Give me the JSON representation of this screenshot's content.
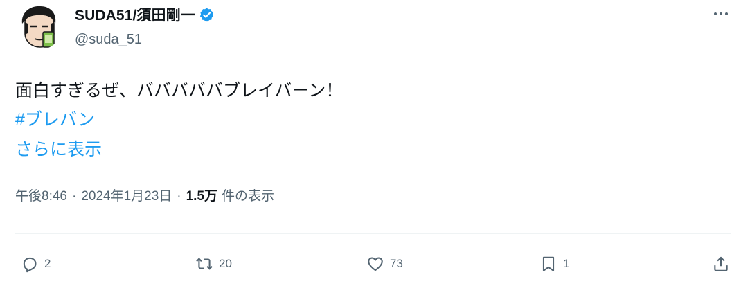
{
  "author": {
    "display_name": "SUDA51/須田剛一",
    "handle": "@suda_51",
    "verified": true,
    "avatar_icon": "cartoon-face-avatar"
  },
  "tweet": {
    "text": "面白すぎるぜ、バババババブレイバーン！",
    "hashtag": "#ブレバン",
    "show_more": "さらに表示"
  },
  "meta": {
    "time": "午後8:46",
    "separator": "·",
    "date": "2024年1月23日",
    "views_count": "1.5万",
    "views_label": "件の表示"
  },
  "actions": {
    "replies": "2",
    "retweets": "20",
    "likes": "73",
    "bookmarks": "1"
  },
  "colors": {
    "link": "#1d9bf0",
    "secondary_text": "#536471",
    "primary_text": "#0f1419",
    "verified_badge": "#1d9bf0"
  }
}
